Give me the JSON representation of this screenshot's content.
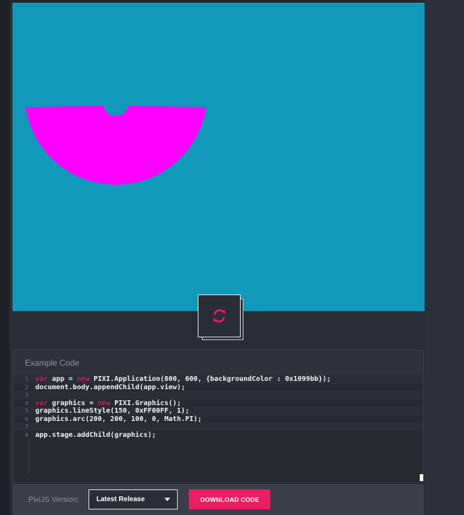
{
  "canvas": {
    "background_color": "#1099bb",
    "shape_color": "#ff00ff"
  },
  "refresh_button": {
    "icon": "refresh-icon",
    "color": "#e91e63"
  },
  "code_panel": {
    "title": "Example Code",
    "lines": [
      {
        "number": "1",
        "text": "var app = new PIXI.Application(800, 600, {backgroundColor : 0x1099bb});"
      },
      {
        "number": "2",
        "text": "document.body.appendChild(app.view);"
      },
      {
        "number": "3",
        "text": ""
      },
      {
        "number": "4",
        "text": "var graphics = new PIXI.Graphics();"
      },
      {
        "number": "5",
        "text": "graphics.lineStyle(150, 0xFF00FF, 1);"
      },
      {
        "number": "6",
        "text": "graphics.arc(200, 200, 100, 0, Math.PI);"
      },
      {
        "number": "7",
        "text": ""
      },
      {
        "number": "8",
        "text": "app.stage.addChild(graphics);"
      }
    ]
  },
  "footer": {
    "version_label": "PixiJS Version:",
    "version_selected": "Latest Release",
    "download_label": "DOWNLOAD CODE",
    "accent_color": "#e91e63"
  }
}
